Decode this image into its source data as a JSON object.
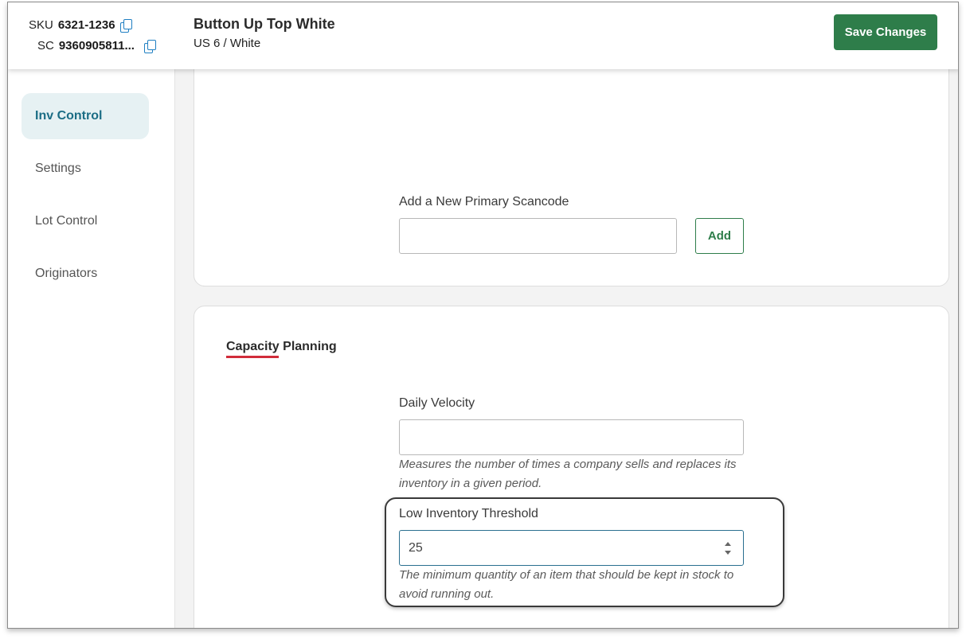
{
  "header": {
    "sku_label": "SKU",
    "sku_value": "6321-1236",
    "sc_label": "SC",
    "sc_value": "9360905811...",
    "product_title": "Button Up Top White",
    "product_variant": "US 6 / White",
    "save_label": "Save Changes"
  },
  "sidebar": {
    "items": [
      {
        "label": "Inv Control",
        "active": true
      },
      {
        "label": "Settings",
        "active": false
      },
      {
        "label": "Lot Control",
        "active": false
      },
      {
        "label": "Originators",
        "active": false
      }
    ]
  },
  "scancode": {
    "label": "Add a New Primary Scancode",
    "value": "",
    "add_label": "Add"
  },
  "capacity": {
    "title": "Capacity Planning",
    "daily_velocity": {
      "label": "Daily Velocity",
      "value": "",
      "help": "Measures the number of times a company sells and replaces its inventory in a given period."
    },
    "low_threshold": {
      "label": "Low Inventory Threshold",
      "value": "25",
      "help": "The minimum quantity of an item that should be kept in stock to avoid running out."
    }
  },
  "colors": {
    "accent_green": "#2e7d4a",
    "active_nav_bg": "#e6f1f3",
    "active_nav_text": "#1b6d85",
    "underline_red": "#d12c3a",
    "copy_icon": "#1f7fc2"
  },
  "icons": {
    "copy": "copy-icon",
    "spinner": "number-spinner-icon"
  }
}
